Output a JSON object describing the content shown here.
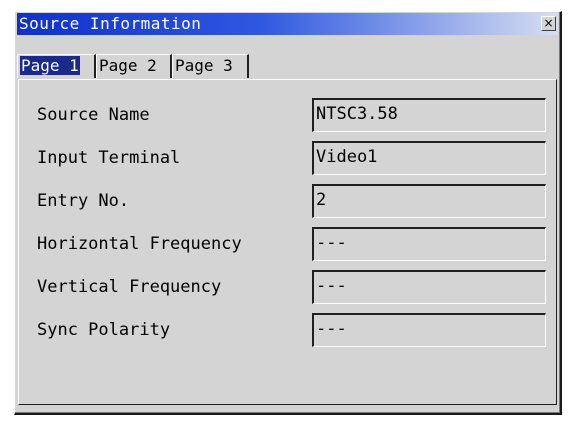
{
  "window": {
    "title": "Source Information",
    "close_label": "×"
  },
  "tabs": [
    {
      "label": "Page 1",
      "active": true
    },
    {
      "label": "Page 2",
      "active": false
    },
    {
      "label": "Page 3",
      "active": false
    }
  ],
  "rows": [
    {
      "label": "Source Name",
      "value": "NTSC3.58"
    },
    {
      "label": "Input Terminal",
      "value": "Video1"
    },
    {
      "label": "Entry No.",
      "value": "2"
    },
    {
      "label": "Horizontal Frequency",
      "value": "---"
    },
    {
      "label": "Vertical Frequency",
      "value": "---"
    },
    {
      "label": "Sync Polarity",
      "value": "---"
    }
  ],
  "colors": {
    "title_bar_start": "#1030c8",
    "title_bar_end": "#d6def2",
    "window_face": "#d4d4d4",
    "active_tab": "#1a2a8a"
  }
}
